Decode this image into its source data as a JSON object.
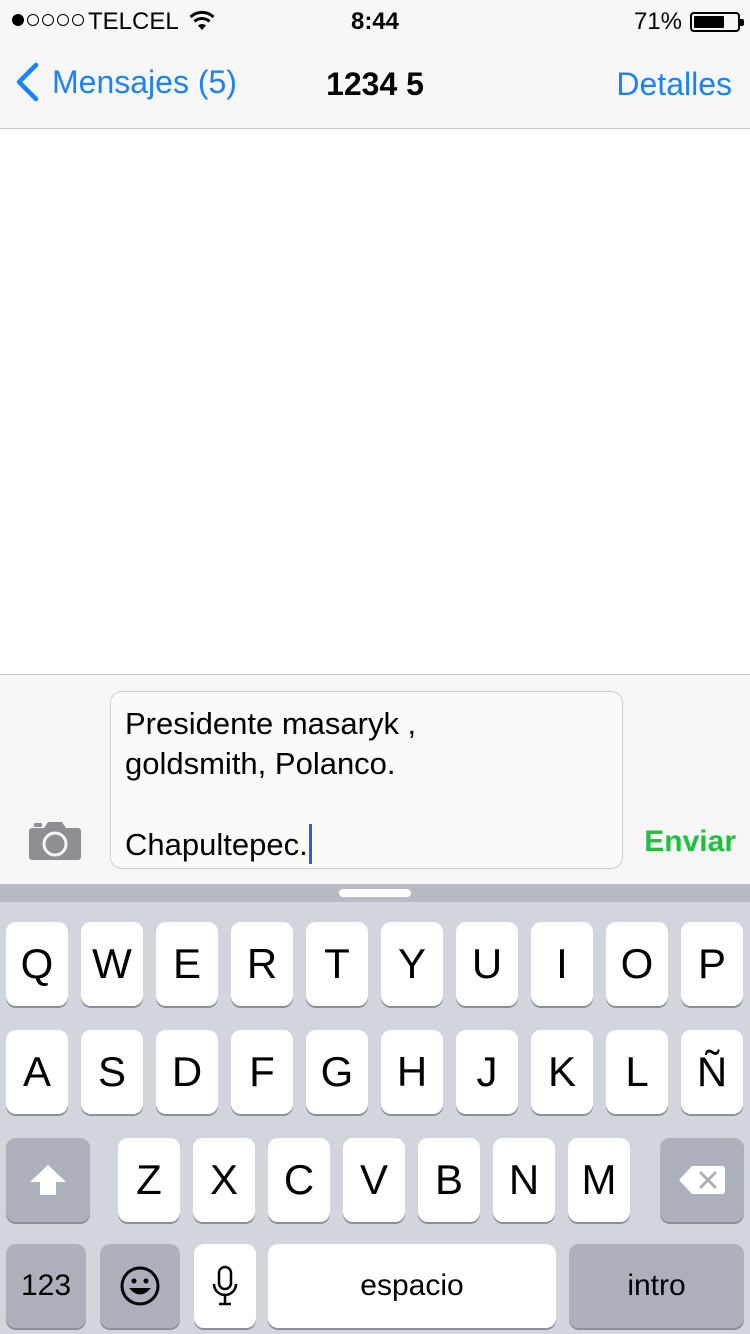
{
  "status_bar": {
    "signal_icon": "signal-dots-icon",
    "carrier": "TELCEL",
    "wifi_icon": "wifi-icon",
    "time": "8:44",
    "battery_percent": "71%",
    "battery_level": 0.71
  },
  "nav": {
    "back_label": "Mensajes (5)",
    "title": "1234 5",
    "details_label": "Detalles"
  },
  "compose": {
    "camera_icon": "camera-icon",
    "lines": [
      "Presidente masaryk ,",
      "goldsmith, Polanco.",
      "",
      "Chapultepec."
    ],
    "send_label": "Enviar"
  },
  "keyboard": {
    "row1": [
      "Q",
      "W",
      "E",
      "R",
      "T",
      "Y",
      "U",
      "I",
      "O",
      "P"
    ],
    "row2": [
      "A",
      "S",
      "D",
      "F",
      "G",
      "H",
      "J",
      "K",
      "L",
      "Ñ"
    ],
    "row3": [
      "Z",
      "X",
      "C",
      "V",
      "B",
      "N",
      "M"
    ],
    "numbers_label": "123",
    "space_label": "espacio",
    "return_label": "intro",
    "shift_icon": "shift-icon",
    "backspace_icon": "backspace-icon",
    "emoji_icon": "emoji-icon",
    "mic_icon": "microphone-icon"
  },
  "colors": {
    "accent": "#1a82fb",
    "send": "#1dc13c",
    "caret": "#2b5fd9"
  }
}
